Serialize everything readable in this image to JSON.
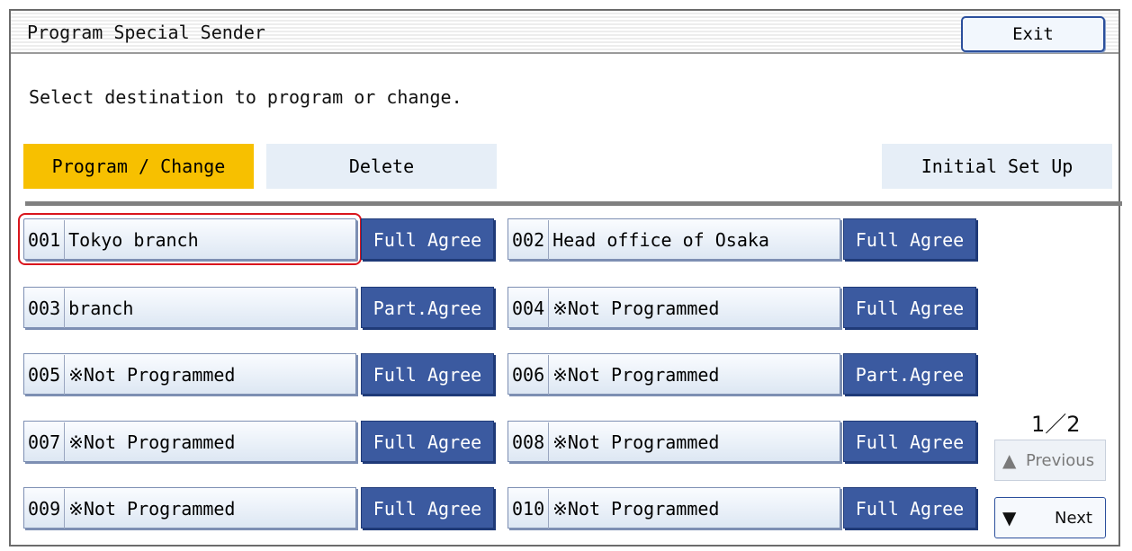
{
  "header": {
    "title": "Program Special Sender",
    "exit_label": "Exit"
  },
  "instruction": "Select destination to program or change.",
  "modes": {
    "program_change": "Program / Change",
    "delete": "Delete",
    "initial_setup": "Initial Set Up"
  },
  "destinations": [
    {
      "num": "001",
      "name": "Tokyo branch",
      "agree": "Full Agree"
    },
    {
      "num": "002",
      "name": "Head office of Osaka",
      "agree": "Full Agree"
    },
    {
      "num": "003",
      "name": "branch",
      "agree": "Part.Agree"
    },
    {
      "num": "004",
      "name": "※Not Programmed",
      "agree": "Full Agree"
    },
    {
      "num": "005",
      "name": "※Not Programmed",
      "agree": "Full Agree"
    },
    {
      "num": "006",
      "name": "※Not Programmed",
      "agree": "Part.Agree"
    },
    {
      "num": "007",
      "name": "※Not Programmed",
      "agree": "Full Agree"
    },
    {
      "num": "008",
      "name": "※Not Programmed",
      "agree": "Full Agree"
    },
    {
      "num": "009",
      "name": "※Not Programmed",
      "agree": "Full Agree"
    },
    {
      "num": "010",
      "name": "※Not Programmed",
      "agree": "Full Agree"
    }
  ],
  "pagination": {
    "indicator": "1／2",
    "previous_label": "Previous",
    "next_label": "Next"
  },
  "colors": {
    "active_tab": "#f7c000",
    "agree_button": "#3b5aa0",
    "selection_outline": "#d9161d"
  },
  "icons": {
    "previous": "triangle-up-icon",
    "next": "triangle-down-icon"
  }
}
